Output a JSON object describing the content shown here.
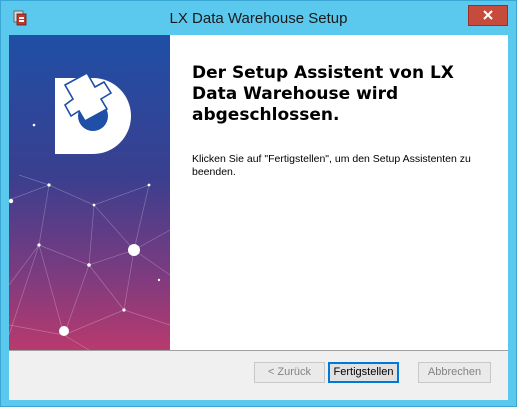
{
  "window": {
    "title": "LX Data Warehouse Setup",
    "close_label": "x"
  },
  "content": {
    "heading": "Der Setup Assistent von LX Data Warehouse wird abgeschlossen.",
    "description": "Klicken Sie auf \"Fertigstellen\", um den Setup Assistenten zu beenden."
  },
  "buttons": {
    "back": "< Zurück",
    "finish": "Fertigstellen",
    "cancel": "Abbrechen"
  },
  "colors": {
    "titlebar": "#5bc8ee",
    "close": "#c74b3c",
    "banner_top": "#1f4fa6",
    "banner_bottom": "#b83a6e"
  },
  "icons": {
    "app": "setup-app-icon",
    "logo": "puzzle-logo-icon",
    "close": "close-icon"
  }
}
